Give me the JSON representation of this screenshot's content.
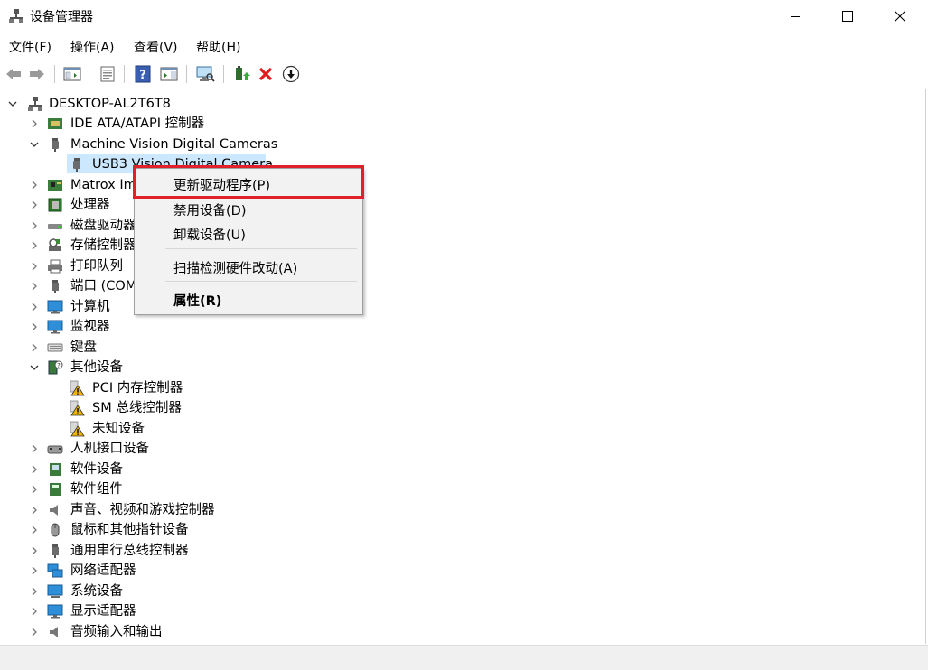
{
  "window": {
    "title": "设备管理器",
    "minimize_icon": "minimize-icon",
    "maximize_icon": "maximize-icon",
    "close_icon": "close-icon"
  },
  "menu": {
    "file": "文件(F)",
    "action": "操作(A)",
    "view": "查看(V)",
    "help": "帮助(H)"
  },
  "toolbar": {
    "icons": [
      "back-icon",
      "forward-icon",
      "show-hide-console-tree-icon",
      "properties-icon",
      "help-icon",
      "action-pane-icon",
      "scan-hardware-icon",
      "update-driver-icon",
      "uninstall-device-icon",
      "enable-device-icon"
    ]
  },
  "tree": {
    "root": "DESKTOP-AL2T6T8",
    "items": [
      {
        "label": "IDE ATA/ATAPI 控制器",
        "expanded": false
      },
      {
        "label": "Machine Vision Digital Cameras",
        "expanded": true
      },
      {
        "label": "USB3 Vision Digital Camera",
        "child": true,
        "selected": true
      },
      {
        "label": "Matrox Im",
        "expanded": false
      },
      {
        "label": "处理器",
        "expanded": false
      },
      {
        "label": "磁盘驱动器",
        "expanded": false
      },
      {
        "label": "存储控制器",
        "expanded": false
      },
      {
        "label": "打印队列",
        "expanded": false
      },
      {
        "label": "端口 (COM",
        "expanded": false
      },
      {
        "label": "计算机",
        "expanded": false
      },
      {
        "label": "监视器",
        "expanded": false
      },
      {
        "label": "键盘",
        "expanded": false
      },
      {
        "label": "其他设备",
        "expanded": true
      },
      {
        "label": "PCI 内存控制器",
        "child": true,
        "warning": true
      },
      {
        "label": "SM 总线控制器",
        "child": true,
        "warning": true
      },
      {
        "label": "未知设备",
        "child": true,
        "warning": true
      },
      {
        "label": "人机接口设备",
        "expanded": false
      },
      {
        "label": "软件设备",
        "expanded": false
      },
      {
        "label": "软件组件",
        "expanded": false
      },
      {
        "label": "声音、视频和游戏控制器",
        "expanded": false
      },
      {
        "label": "鼠标和其他指针设备",
        "expanded": false
      },
      {
        "label": "通用串行总线控制器",
        "expanded": false
      },
      {
        "label": "网络适配器",
        "expanded": false
      },
      {
        "label": "系统设备",
        "expanded": false
      },
      {
        "label": "显示适配器",
        "expanded": false
      },
      {
        "label": "音频输入和输出",
        "expanded": false
      }
    ]
  },
  "context_menu": {
    "update_driver": "更新驱动程序(P)",
    "disable_device": "禁用设备(D)",
    "uninstall_device": "卸载设备(U)",
    "scan_hardware": "扫描检测硬件改动(A)",
    "properties": "属性(R)"
  },
  "colors": {
    "selection": "#cce8ff",
    "highlight_box": "#e0202a",
    "warning": "#f0b400"
  }
}
